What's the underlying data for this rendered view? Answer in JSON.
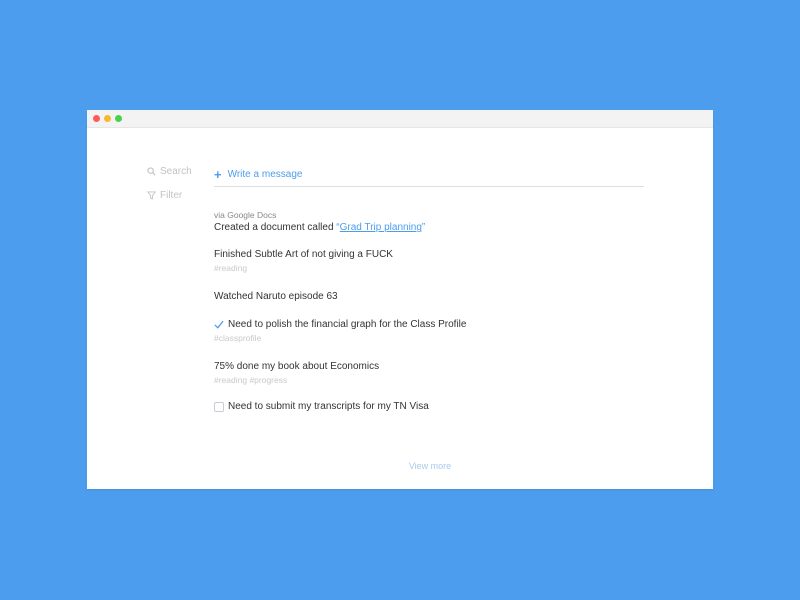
{
  "sidebar": {
    "search_label": "Search",
    "filter_label": "Filter"
  },
  "compose": {
    "plus": "+",
    "label": "Write a message"
  },
  "feed": {
    "items": [
      {
        "meta": "via Google Docs",
        "text_prefix": "Created a document called ",
        "open_quote": "“",
        "link_text": "Grad Trip planning",
        "close_quote": "”"
      },
      {
        "text": "Finished Subtle Art of not giving a FUCK",
        "tags": "#reading"
      },
      {
        "text": "Watched Naruto episode 63"
      },
      {
        "text": "Need to polish the financial graph for the Class Profile",
        "tags": "#classprofile",
        "checked": true
      },
      {
        "text": "75% done my book about Economics",
        "tags": "#reading #progress"
      },
      {
        "text": "Need to submit my transcripts for my TN Visa",
        "checked": false
      }
    ]
  },
  "footer": {
    "view_more": "View more"
  },
  "colors": {
    "background": "#4c9ded",
    "accent": "#4c9ded",
    "close_button": "#fc5b57",
    "minimize_button": "#f8b82e",
    "maximize_button": "#4bd04b"
  },
  "icons": {
    "search": "search-icon",
    "filter": "filter-icon",
    "check": "checkmark-icon"
  }
}
